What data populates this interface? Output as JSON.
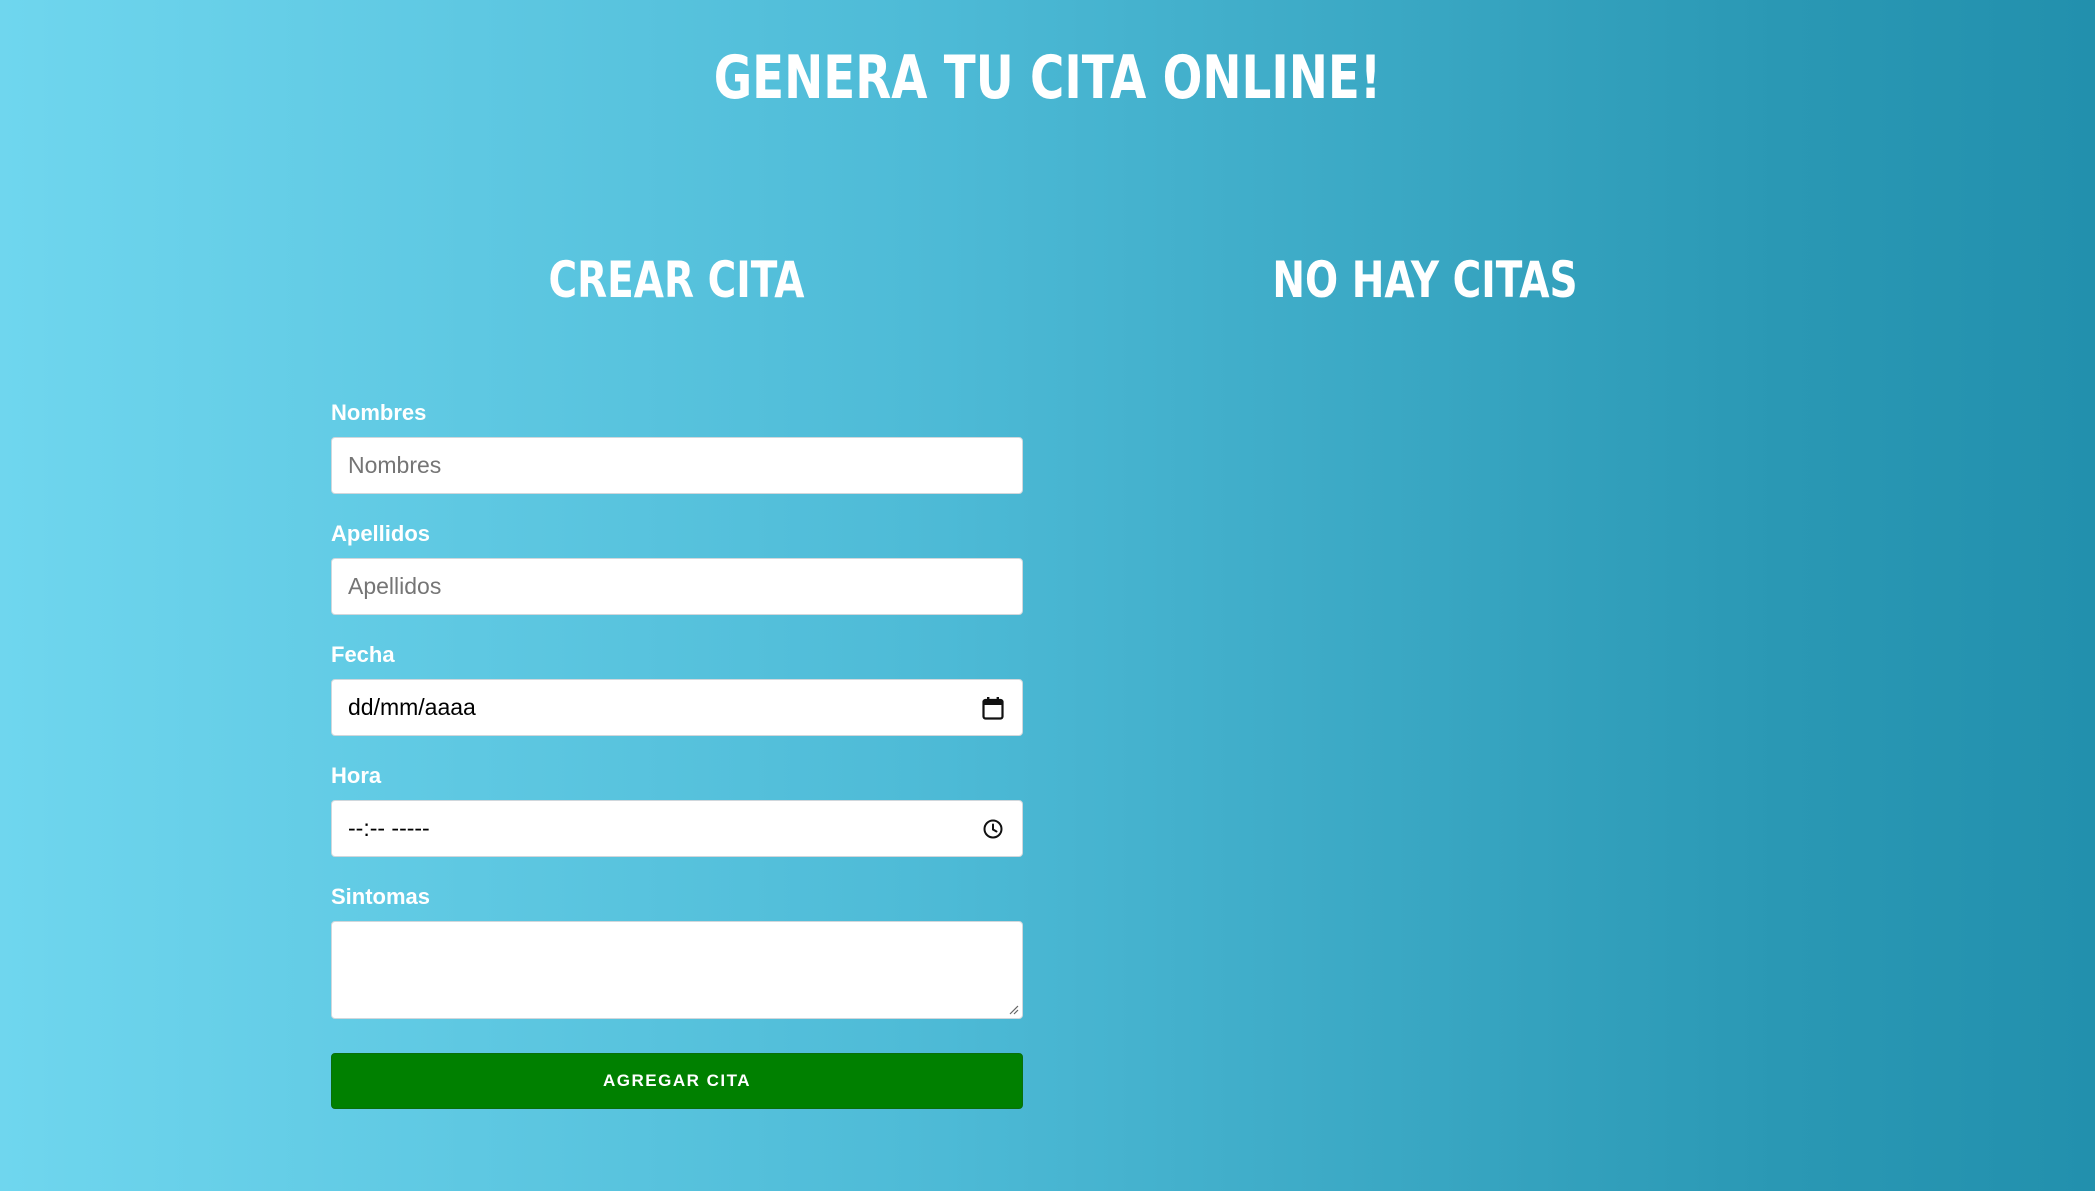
{
  "header": {
    "title": "Genera tu cita online!"
  },
  "form_section": {
    "title": "Crear cita",
    "fields": {
      "nombres": {
        "label": "Nombres",
        "placeholder": "Nombres"
      },
      "apellidos": {
        "label": "Apellidos",
        "placeholder": "Apellidos"
      },
      "fecha": {
        "label": "Fecha",
        "placeholder": "dd/mm/aaaa",
        "icon": "calendar-icon"
      },
      "hora": {
        "label": "Hora",
        "placeholder": "--:-- -----",
        "icon": "clock-icon"
      },
      "sintomas": {
        "label": "Sintomas",
        "value": ""
      }
    },
    "submit_label": "Agregar cita",
    "submit_color": "#008000"
  },
  "list_section": {
    "title": "No hay citas"
  }
}
